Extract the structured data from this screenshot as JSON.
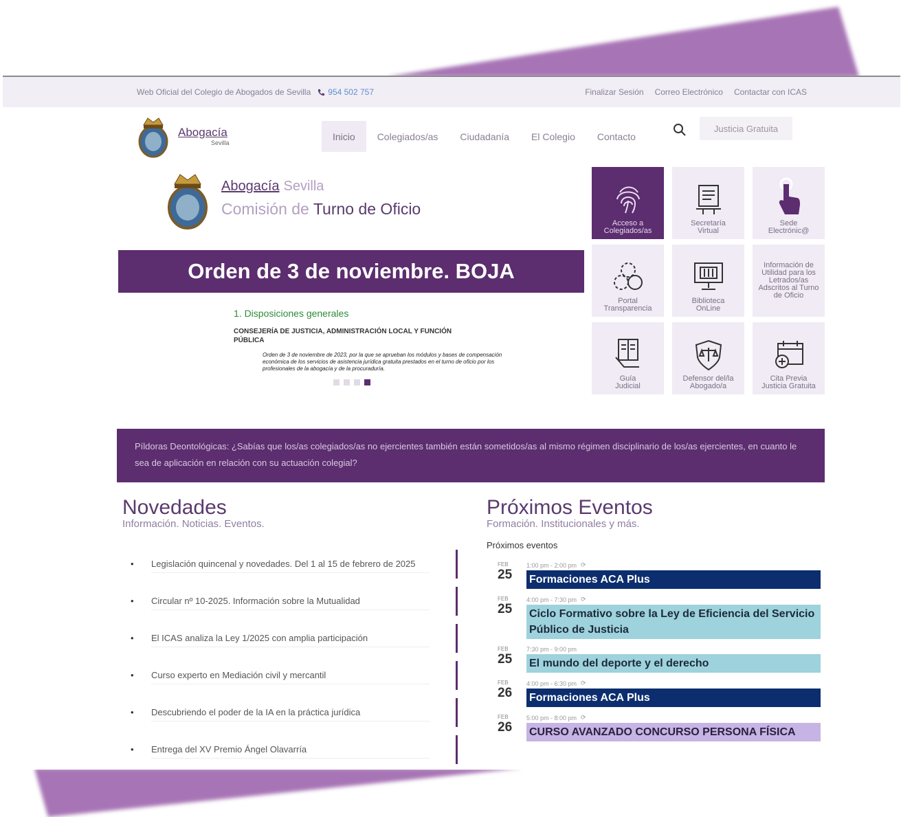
{
  "topbar": {
    "official": "Web Oficial del Colegio de Abogados de Sevilla",
    "phone": "954 502 757",
    "links": [
      "Finalizar Sesión",
      "Correo Electrónico",
      "Contactar con ICAS"
    ]
  },
  "brand": {
    "word": "Abogacía",
    "city": "Sevilla"
  },
  "menu": [
    "Inicio",
    "Colegiados/as",
    "Ciudadanía",
    "El Colegio",
    "Contacto"
  ],
  "justicia_button": "Justicia Gratuita",
  "hero": {
    "brand": "Abogacía",
    "city": "Sevilla",
    "line2_a": "Comisión de",
    "line2_b": "Turno de Oficio"
  },
  "banner": "Orden de 3 de noviembre. BOJA",
  "doc": {
    "heading": "1. Disposiciones generales",
    "ministry": "CONSEJERÍA DE JUSTICIA, ADMINISTRACIÓN LOCAL Y FUNCIÓN PÚBLICA",
    "body": "Orden de 3 de noviembre de 2023, por la que se aprueban los módulos y bases de compensación económica de los servicios de asistencia jurídica gratuita prestados en el turno de oficio por los profesionales de la abogacía y de la procuraduría."
  },
  "tiles": [
    {
      "l1": "Acceso a",
      "l2": "Colegiados/as"
    },
    {
      "l1": "Secretaría",
      "l2": "Virtual"
    },
    {
      "l1": "Sede",
      "l2": "Electrónic@"
    },
    {
      "l1": "Portal",
      "l2": "Transparencia"
    },
    {
      "l1": "Biblioteca",
      "l2": "OnLine"
    },
    {
      "text": "Información de Utilidad para los Letrados/as Adscritos al Turno de Oficio"
    },
    {
      "l1": "Guía",
      "l2": "Judicial"
    },
    {
      "l1": "Defensor del/la",
      "l2": "Abogado/a"
    },
    {
      "l1": "Cita Previa",
      "l2": "Justicia Gratuita"
    }
  ],
  "pildoras": "Píldoras Deontológicas: ¿Sabías que los/as colegiados/as no ejercientes también están sometidos/as al mismo régimen disciplinario de los/as ejercientes, en cuanto le sea de aplicación en relación con su actuación colegial?",
  "novedades": {
    "title": "Novedades",
    "subtitle": "Información. Noticias. Eventos.",
    "items": [
      "Legislación quincenal y novedades. Del 1 al 15 de febrero de 2025",
      "Circular nº 10-2025. Información sobre la Mutualidad",
      "El ICAS analiza la Ley 1/2025 con amplia participación",
      "Curso experto en Mediación civil y mercantil",
      "Descubriendo el poder de la IA en la práctica jurídica",
      "Entrega del XV Premio Ángel Olavarría"
    ]
  },
  "eventos": {
    "title": "Próximos Eventos",
    "subtitle": "Formación. Institucionales y más.",
    "label": "Próximos eventos",
    "items": [
      {
        "month": "FEB",
        "day": "25",
        "time": "1:00 pm - 2:00 pm",
        "title": "Formaciones ACA Plus"
      },
      {
        "month": "FEB",
        "day": "25",
        "time": "4:00 pm - 7:30 pm",
        "title": "Ciclo Formativo sobre la Ley de Eficiencia del Servicio Público de Justicia"
      },
      {
        "month": "FEB",
        "day": "25",
        "time": "7:30 pm - 9:00 pm",
        "title": "El mundo del deporte y el derecho"
      },
      {
        "month": "FEB",
        "day": "26",
        "time": "4:00 pm - 6:30 pm",
        "title": "Formaciones ACA Plus"
      },
      {
        "month": "FEB",
        "day": "26",
        "time": "5:00 pm - 8:00 pm",
        "title": "CURSO AVANZADO CONCURSO PERSONA FÍSICA"
      }
    ]
  }
}
